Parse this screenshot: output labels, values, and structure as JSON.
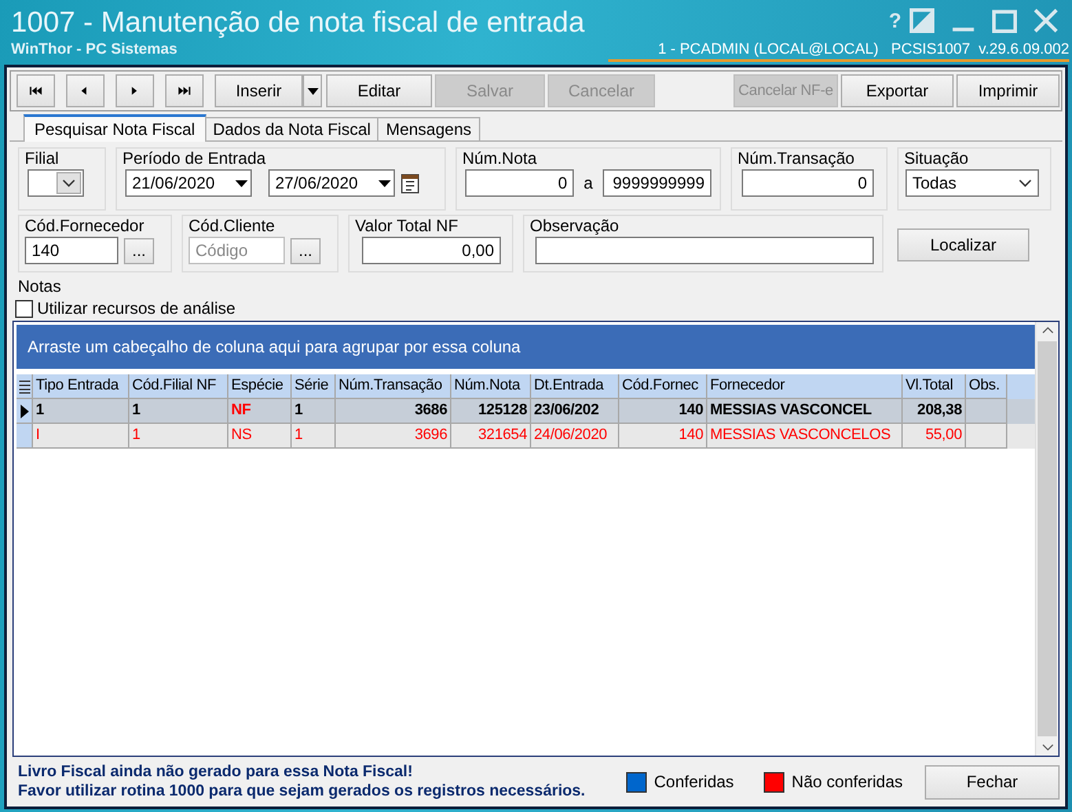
{
  "window": {
    "title": "1007 - Manutenção de nota fiscal de entrada",
    "subtitle": "WinThor - PC Sistemas",
    "session": "1 - PCADMIN (LOCAL@LOCAL)   PCSIS1007  v.29.6.09.002",
    "help": "?"
  },
  "toolbar": {
    "nav_buttons": [
      {
        "kind": "first"
      },
      {
        "kind": "prev"
      },
      {
        "kind": "next"
      },
      {
        "kind": "last"
      }
    ],
    "buttons_left": [
      {
        "label": "Inserir",
        "disabled": false,
        "dropdown": true
      },
      {
        "label": "Editar",
        "disabled": false,
        "dropdown": false
      },
      {
        "label": "Salvar",
        "disabled": true,
        "dropdown": false
      },
      {
        "label": "Cancelar",
        "disabled": true,
        "dropdown": false
      }
    ],
    "buttons_right": [
      {
        "label": "Cancelar NF-e",
        "disabled": true
      },
      {
        "label": "Exportar",
        "disabled": false
      },
      {
        "label": "Imprimir",
        "disabled": false
      }
    ]
  },
  "tabs": [
    {
      "label": "Pesquisar Nota Fiscal",
      "selected": true
    },
    {
      "label": "Dados da Nota Fiscal",
      "selected": false
    },
    {
      "label": "Mensagens",
      "selected": false
    }
  ],
  "filters": {
    "filial": {
      "label": "Filial"
    },
    "periodo": {
      "label": "Período de Entrada",
      "from": "21/06/2020",
      "to": "27/06/2020"
    },
    "num_nota": {
      "label": "Núm.Nota",
      "from": "0",
      "separator": "a",
      "to": "9999999999"
    },
    "num_transacao": {
      "label": "Núm.Transação",
      "value": "0"
    },
    "situacao": {
      "label": "Situação",
      "value": "Todas"
    },
    "cod_fornecedor": {
      "label": "Cód.Fornecedor",
      "value": "140",
      "button": "..."
    },
    "cod_cliente": {
      "label": "Cód.Cliente",
      "placeholder": "Código",
      "button": "..."
    },
    "valor_total": {
      "label": "Valor Total NF",
      "value": "0,00"
    },
    "observacao": {
      "label": "Observação"
    },
    "search_button": "Localizar"
  },
  "notas": {
    "label": "Notas",
    "analysis": {
      "label": "Utilizar recursos de análise",
      "checked": false
    }
  },
  "table": {
    "group_hint": "Arraste um cabeçalho de coluna aqui para agrupar por essa coluna",
    "columns": [
      {
        "label": "Tipo Entrada",
        "kind": "text"
      },
      {
        "label": "Cód.Filial NF",
        "kind": "text"
      },
      {
        "label": "Espécie",
        "kind": "text"
      },
      {
        "label": "Série",
        "kind": "text"
      },
      {
        "label": "Núm.Transação",
        "kind": "number"
      },
      {
        "label": "Núm.Nota",
        "kind": "number"
      },
      {
        "label": "Dt.Entrada",
        "kind": "text"
      },
      {
        "label": "Cód.Fornec",
        "kind": "number"
      },
      {
        "label": "Fornecedor",
        "kind": "text"
      },
      {
        "label": "Vl.Total",
        "kind": "number"
      },
      {
        "label": "Obs.",
        "kind": "text"
      }
    ],
    "rows": [
      {
        "selected": true,
        "color": "#000000",
        "cells": [
          {
            "text": "1"
          },
          {
            "text": "1"
          },
          {
            "text": "NF",
            "color": "#ff0000"
          },
          {
            "text": "1"
          },
          {
            "text": "3686"
          },
          {
            "text": "125128"
          },
          {
            "text": "23/06/202"
          },
          {
            "text": "140"
          },
          {
            "text": "MESSIAS VASCONCEL"
          },
          {
            "text": "208,38"
          }
        ]
      },
      {
        "selected": false,
        "color": "#ff0000",
        "cells": [
          {
            "text": "I"
          },
          {
            "text": "1"
          },
          {
            "text": "NS"
          },
          {
            "text": "1"
          },
          {
            "text": "3696"
          },
          {
            "text": "321654"
          },
          {
            "text": "24/06/2020"
          },
          {
            "text": "140"
          },
          {
            "text": "MESSIAS VASCONCELOS"
          },
          {
            "text": "55,00"
          }
        ]
      }
    ]
  },
  "footer": {
    "messages": [
      "Livro Fiscal ainda não gerado para essa Nota Fiscal!",
      "Favor utilizar rotina 1000 para que sejam gerados os registros necessários."
    ],
    "legend": [
      {
        "label": "Conferidas",
        "color": "#0066cc"
      },
      {
        "label": "Não conferidas",
        "color": "#ff0000"
      }
    ],
    "close_button": "Fechar"
  }
}
